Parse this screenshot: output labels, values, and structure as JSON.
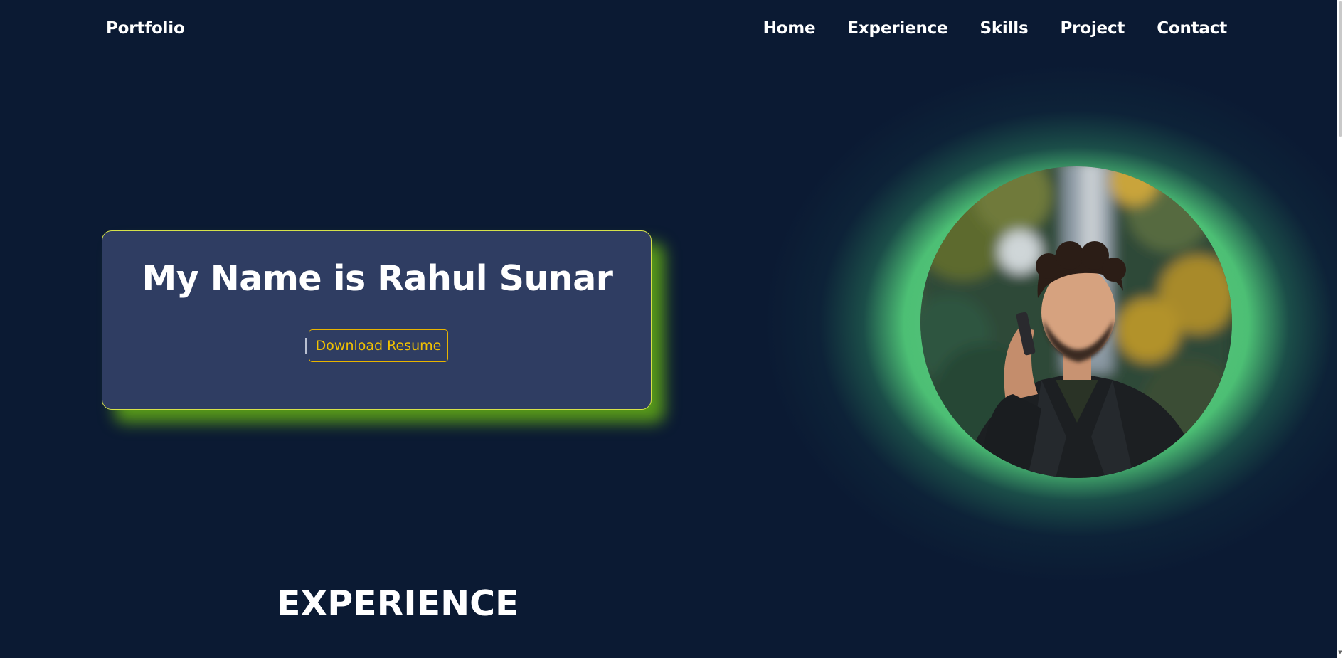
{
  "nav": {
    "brand": "Portfolio",
    "links": [
      "Home",
      "Experience",
      "Skills",
      "Project",
      "Contact"
    ]
  },
  "hero": {
    "title": "My Name is Rahul Sunar",
    "button": "Download Resume"
  },
  "experience": {
    "heading": "EXPERIENCE"
  },
  "colors": {
    "background": "#0b1a33",
    "card": "#2f3d62",
    "card_border": "#d6e14a",
    "card_shadow": "#5ca018",
    "button_accent": "#f2c200",
    "glow": "#50c878"
  },
  "icons": {
    "scroll_down": "triangle-down"
  }
}
